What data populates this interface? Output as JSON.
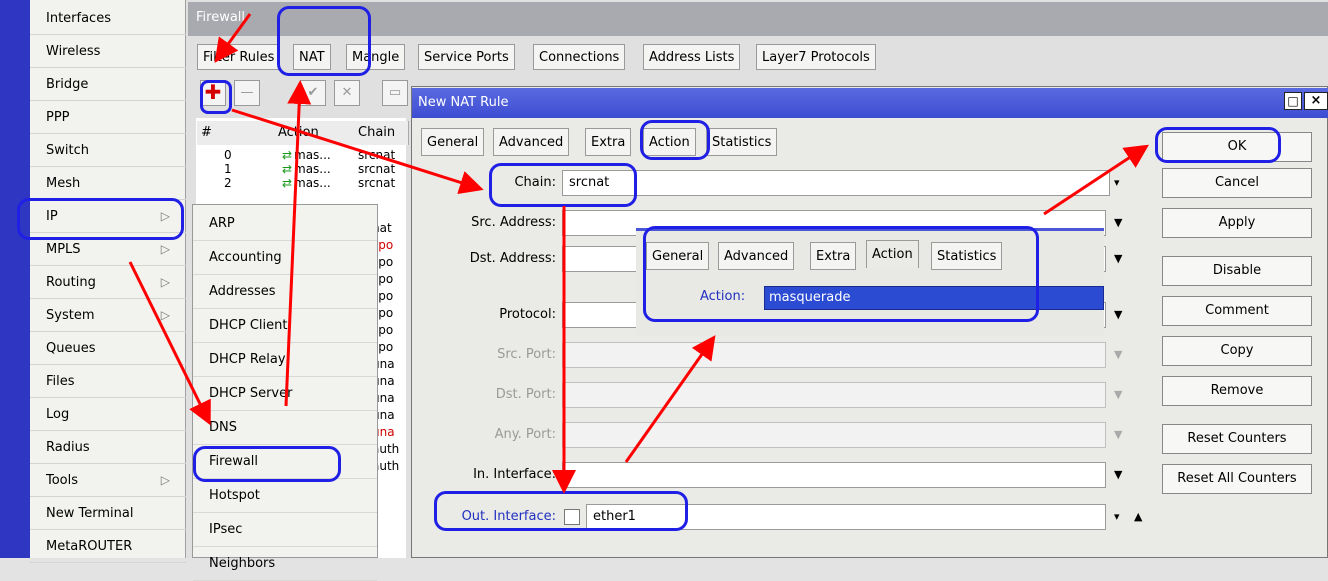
{
  "left_menu": {
    "items": [
      {
        "label": "Interfaces",
        "has_sub": false
      },
      {
        "label": "Wireless",
        "has_sub": false
      },
      {
        "label": "Bridge",
        "has_sub": false
      },
      {
        "label": "PPP",
        "has_sub": false
      },
      {
        "label": "Switch",
        "has_sub": false
      },
      {
        "label": "Mesh",
        "has_sub": false
      },
      {
        "label": "IP",
        "has_sub": true
      },
      {
        "label": "MPLS",
        "has_sub": true
      },
      {
        "label": "Routing",
        "has_sub": true
      },
      {
        "label": "System",
        "has_sub": true
      },
      {
        "label": "Queues",
        "has_sub": false
      },
      {
        "label": "Files",
        "has_sub": false
      },
      {
        "label": "Log",
        "has_sub": false
      },
      {
        "label": "Radius",
        "has_sub": false
      },
      {
        "label": "Tools",
        "has_sub": true
      },
      {
        "label": "New Terminal",
        "has_sub": false
      },
      {
        "label": "MetaROUTER",
        "has_sub": false
      }
    ],
    "submenu_arrow": "▷"
  },
  "ip_submenu": {
    "items": [
      "ARP",
      "Accounting",
      "Addresses",
      "DHCP Client",
      "DHCP Relay",
      "DHCP Server",
      "DNS",
      "Firewall",
      "Hotspot",
      "IPsec",
      "Neighbors"
    ]
  },
  "firewall": {
    "title": "Firewall",
    "tabs": [
      "Filter Rules",
      "NAT",
      "Mangle",
      "Service Ports",
      "Connections",
      "Address Lists",
      "Layer7 Protocols"
    ],
    "columns": {
      "num": "#",
      "action": "Action",
      "chain": "Chain"
    },
    "rows": [
      {
        "num": "0",
        "action": "mas...",
        "chain": "srcnat"
      },
      {
        "num": "1",
        "action": "mas...",
        "chain": "srcnat"
      },
      {
        "num": "2",
        "action": "mas...",
        "chain": "srcnat"
      }
    ],
    "chain_fragments": [
      "nat",
      "spo",
      "spo",
      "spo",
      "spo",
      "spo",
      "spo",
      "spo",
      "una",
      "una",
      "una",
      "una",
      "una",
      "auth",
      "auth"
    ]
  },
  "dialog": {
    "title": "New NAT Rule",
    "tabs": [
      "General",
      "Advanced",
      "Extra",
      "Action",
      "Statistics"
    ],
    "fields": [
      {
        "label": "Chain:",
        "value": "srcnat"
      },
      {
        "label": "Src. Address:",
        "value": ""
      },
      {
        "label": "Dst. Address:",
        "value": ""
      },
      {
        "label": "Protocol:",
        "value": ""
      },
      {
        "label": "Src. Port:",
        "value": ""
      },
      {
        "label": "Dst. Port:",
        "value": ""
      },
      {
        "label": "Any. Port:",
        "value": ""
      },
      {
        "label": "In. Interface:",
        "value": ""
      },
      {
        "label": "Out. Interface:",
        "value": "ether1"
      }
    ],
    "buttons": [
      "OK",
      "Cancel",
      "Apply",
      "Disable",
      "Comment",
      "Copy",
      "Remove",
      "Reset Counters",
      "Reset All Counters"
    ],
    "inset": {
      "tabs": [
        "General",
        "Advanced",
        "Extra",
        "Action",
        "Statistics"
      ],
      "action_label": "Action:",
      "action_value": "masquerade"
    }
  },
  "colors": {
    "highlight": "#1f1fe6",
    "arrow": "#ff0000",
    "title_bar": "#3d4dd2",
    "strip": "#2e36c2"
  }
}
